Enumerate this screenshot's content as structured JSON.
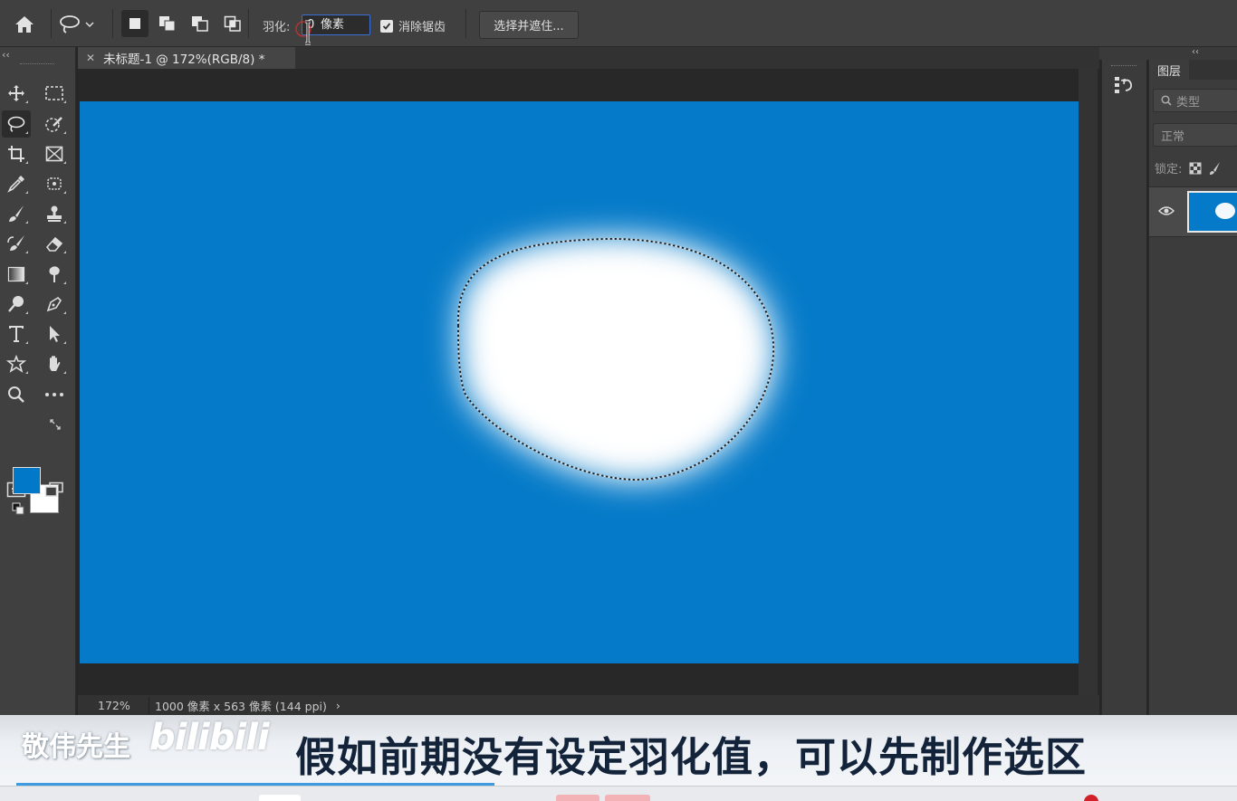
{
  "options_bar": {
    "home_icon": "home-icon",
    "lasso_icon": "lasso-icon",
    "selection_modes": [
      "new-selection-icon",
      "add-to-selection-icon",
      "subtract-from-selection-icon",
      "intersect-selection-icon"
    ],
    "feather_label": "羽化:",
    "feather_value": "0",
    "feather_unit": "像素",
    "antialias_label": "消除锯齿",
    "antialias_checked": true,
    "select_and_mask_label": "选择并遮住..."
  },
  "document": {
    "tab_title": "未标题-1 @ 172%(RGB/8) *",
    "zoom": "172%",
    "info": "1000 像素 x 563 像素 (144 ppi)",
    "canvas_color": "#047ac8"
  },
  "toolbar": {
    "collapse_glyph": "‹‹",
    "foreground_color": "#0178c8",
    "background_color": "#ffffff"
  },
  "layers_panel": {
    "collapse_glyph": "‹‹",
    "tab_label": "图层",
    "filter_placeholder": "类型",
    "blend_mode": "正常",
    "lock_label": "锁定:"
  },
  "caption": {
    "author": "敬伟先生",
    "logo": "bilibili",
    "text": "假如前期没有设定羽化值，可以先制作选区"
  }
}
